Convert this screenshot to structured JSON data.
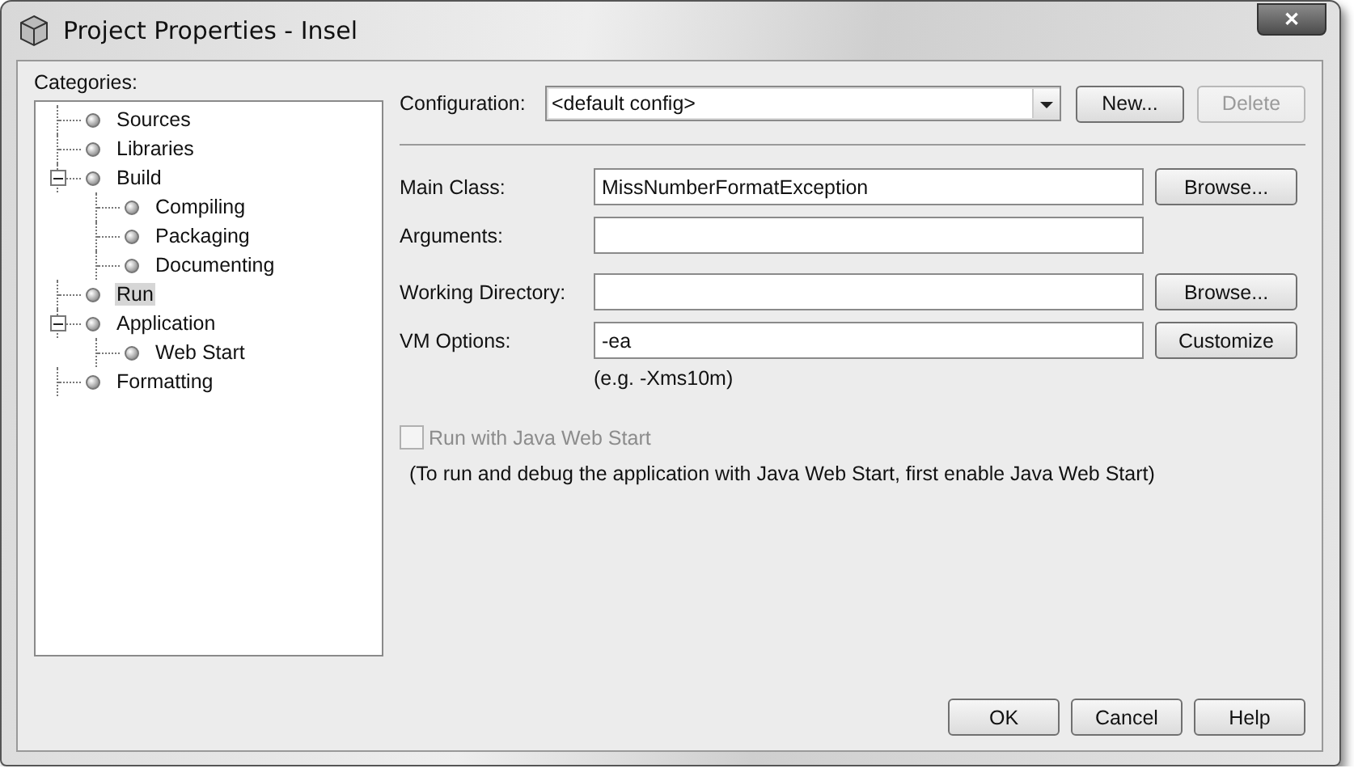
{
  "window": {
    "title": "Project Properties - Insel",
    "close": "✕"
  },
  "categories": {
    "label": "Categories:",
    "items": [
      {
        "label": "Sources",
        "selected": false
      },
      {
        "label": "Libraries",
        "selected": false
      },
      {
        "label": "Build",
        "selected": false,
        "expanded": true,
        "children": [
          {
            "label": "Compiling",
            "selected": false
          },
          {
            "label": "Packaging",
            "selected": false
          },
          {
            "label": "Documenting",
            "selected": false
          }
        ]
      },
      {
        "label": "Run",
        "selected": true
      },
      {
        "label": "Application",
        "selected": false,
        "expanded": true,
        "children": [
          {
            "label": "Web Start",
            "selected": false
          }
        ]
      },
      {
        "label": "Formatting",
        "selected": false
      }
    ]
  },
  "configuration": {
    "label": "Configuration:",
    "value": "<default config>",
    "buttons": [
      {
        "label": "New...",
        "disabled": false
      },
      {
        "label": "Delete",
        "disabled": true
      }
    ]
  },
  "fields": [
    {
      "label": "Main Class:",
      "value": "MissNumberFormatException",
      "button": "Browse..."
    },
    {
      "label": "Arguments:"
    },
    {
      "label": "Working Directory:",
      "button": "Browse..."
    },
    {
      "label": "VM Options:",
      "value": "-ea",
      "button": "Customize",
      "hint": "(e.g. -Xms10m)"
    }
  ],
  "web_start": {
    "label": "Run with Java Web Start",
    "checked": false,
    "disabled": true,
    "note": "(To run and debug the application with Java Web Start, first enable Java Web Start)"
  },
  "buttons": [
    "OK",
    "Cancel",
    "Help"
  ]
}
